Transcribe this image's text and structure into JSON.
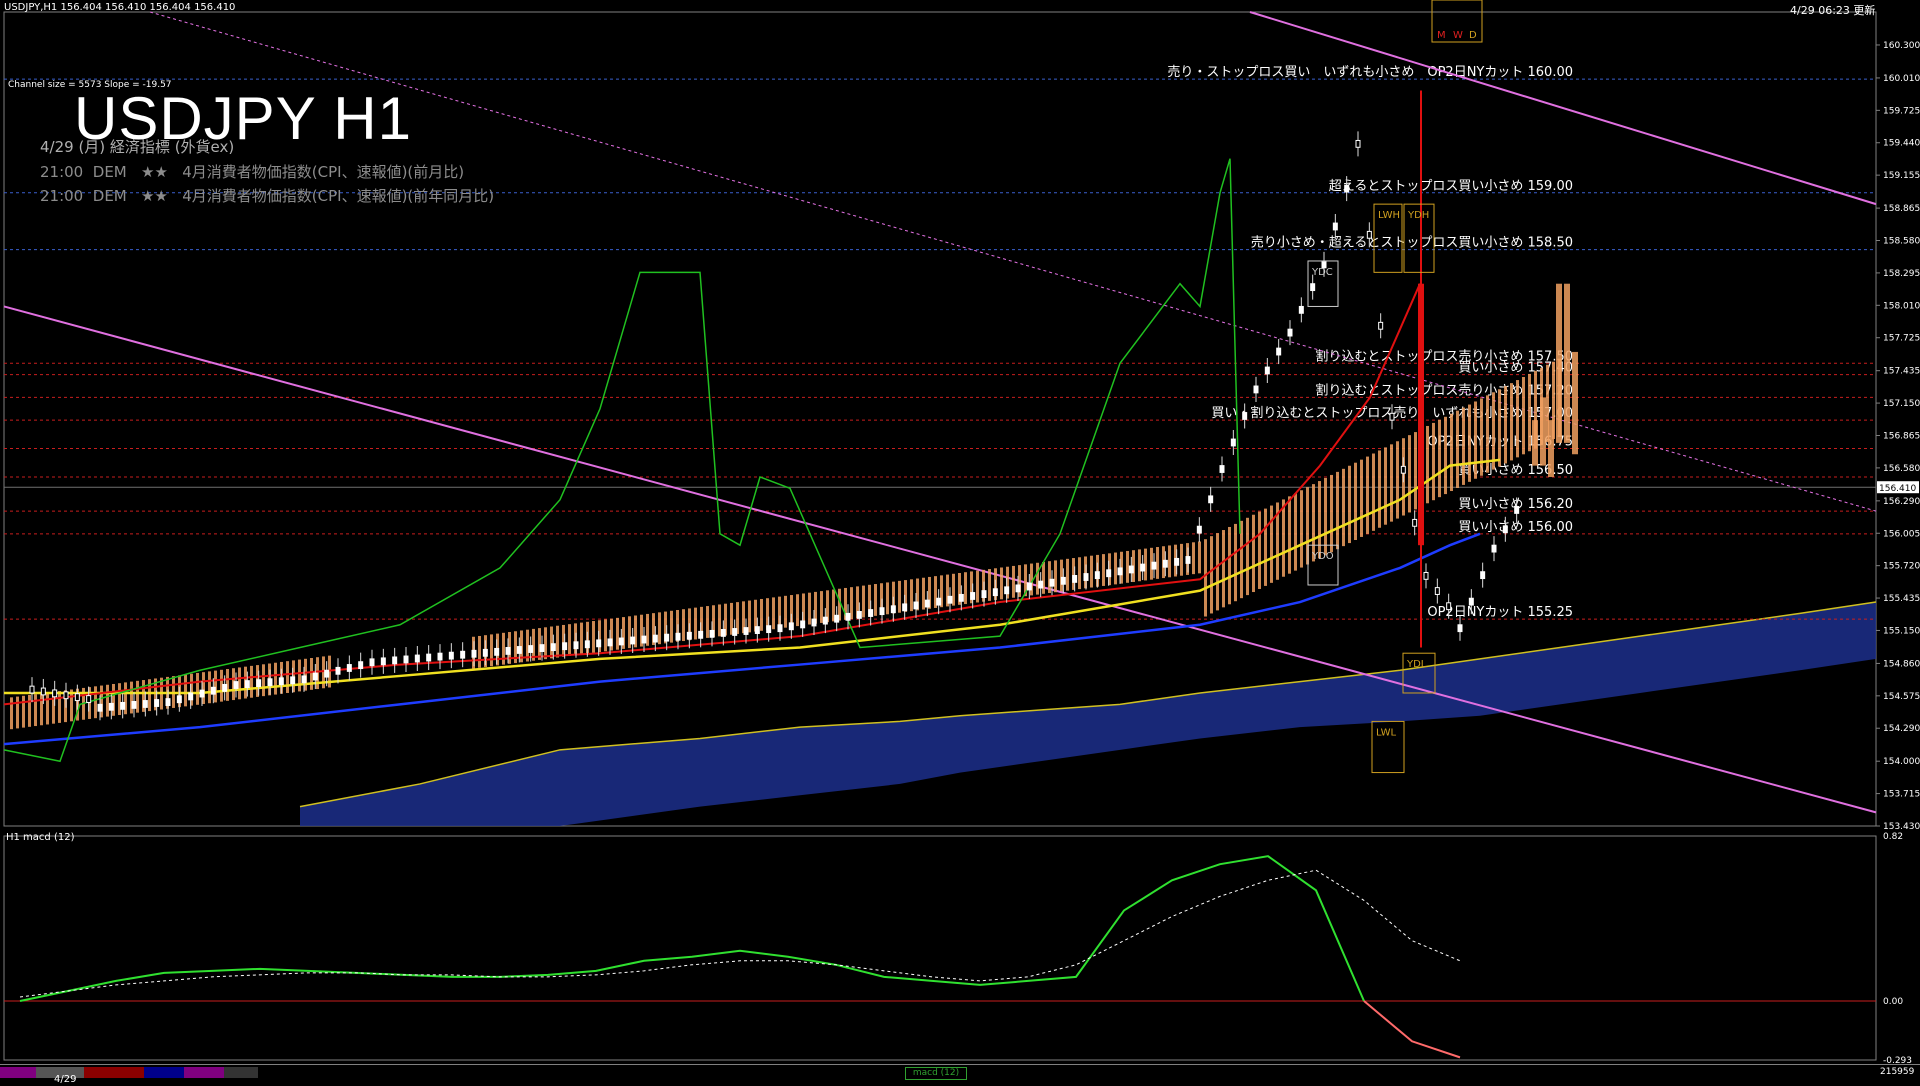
{
  "header": {
    "symbol_info": "USDJPY,H1  156.404 156.410 156.404 156.410",
    "updated": "4/29 06:23 更新"
  },
  "title": "USDJPY H1",
  "channel_info": "Channel size = 5573 Slope = -19.57",
  "events": {
    "heading": "4/29 (月) 経済指標 (外貨ex)",
    "rows": [
      "21:00  DEM   ★★   4月消費者物価指数(CPI、速報値)(前月比)",
      "21:00  DEM   ★★   4月消費者物価指数(CPI、速報値)(前年同月比)"
    ]
  },
  "mwd": [
    "M",
    "W",
    "D"
  ],
  "box_labels": {
    "ydc_top": "YDC",
    "lwh": "LWH",
    "ydh": "YDH",
    "ydo": "YDO",
    "ydl": "YDL",
    "lwl": "LWL"
  },
  "subwindow_label": "H1  macd (12)",
  "bottom_tab_date": "4/29",
  "bottom_right_number": "215959",
  "bottom_mid_label": "macd (12)",
  "colors": {
    "background": "#000000",
    "level_blue": "#3a5fcd",
    "level_red": "#c81e1e",
    "channel": "#e070e0",
    "kumo": "#1c2f8c",
    "ma_yellow": "#f0e020",
    "ma_blue": "#1e3cff",
    "ma_red": "#e01010",
    "chikou_green": "#20c020",
    "macd_green": "#30e030",
    "macd_signal": "#ffffff",
    "macd_neg": "#ff6a6a",
    "bar_orange": "#f0a060"
  },
  "chart_data": {
    "type": "line",
    "title": "USDJPY H1",
    "ylabel": "",
    "ylim": [
      153.43,
      160.59
    ],
    "y_ticks": [
      "160.300",
      "160.010",
      "159.725",
      "159.440",
      "159.155",
      "158.865",
      "158.580",
      "158.295",
      "158.010",
      "157.725",
      "157.435",
      "157.150",
      "156.865",
      "156.580",
      "156.290",
      "156.005",
      "155.720",
      "155.435",
      "155.150",
      "154.860",
      "154.575",
      "154.290",
      "154.000",
      "153.715",
      "153.430"
    ],
    "current_price": "156.410",
    "levels": [
      {
        "price": 160.0,
        "label": "売り・ストップロス買い　いずれも小さめ　OP2日NYカット 160.00",
        "color": "blue"
      },
      {
        "price": 159.0,
        "label": "超えるとストップロス買い小さめ 159.00",
        "color": "blue"
      },
      {
        "price": 158.5,
        "label": "売り小さめ・超えるとストップロス買い小さめ 158.50",
        "color": "blue"
      },
      {
        "price": 157.5,
        "label": "割り込むとストップロス売り小さめ 157.50",
        "color": "red"
      },
      {
        "price": 157.4,
        "label": "買い小さめ 157.40",
        "color": "red"
      },
      {
        "price": 157.2,
        "label": "割り込むとストップロス売り小さめ 157.20",
        "color": "red"
      },
      {
        "price": 157.0,
        "label": "買い・割り込むとストップロス売り　いずれも小さめ 157.00",
        "color": "red"
      },
      {
        "price": 156.75,
        "label": "OP2日NYカット 156.75",
        "color": "red"
      },
      {
        "price": 156.5,
        "label": "買い小さめ 156.50",
        "color": "red"
      },
      {
        "price": 156.2,
        "label": "買い小さめ 156.20",
        "color": "red"
      },
      {
        "price": 156.0,
        "label": "買い小さめ 156.00",
        "color": "red"
      },
      {
        "price": 155.25,
        "label": "OP2日NYカット 155.25",
        "color": "red"
      }
    ],
    "series": [
      {
        "name": "close",
        "x": [
          0,
          10,
          20,
          30,
          40,
          50,
          60,
          70,
          80,
          90,
          100,
          110,
          120,
          130,
          140,
          150,
          160,
          170,
          175,
          180,
          185,
          190,
          195,
          200,
          205,
          210,
          215,
          220
        ],
        "values": [
          154.6,
          154.5,
          154.55,
          154.7,
          154.75,
          154.9,
          154.95,
          155.0,
          155.05,
          155.1,
          155.15,
          155.2,
          155.3,
          155.4,
          155.5,
          155.6,
          155.7,
          155.8,
          156.6,
          157.3,
          157.8,
          158.4,
          159.4,
          157.0,
          155.6,
          155.2,
          155.9,
          156.41
        ]
      }
    ],
    "macd": {
      "ylim": [
        -0.293,
        0.82
      ],
      "y_ticks": [
        "0.82",
        "0.00",
        "-0.293"
      ],
      "main": [
        0.0,
        0.05,
        0.1,
        0.14,
        0.15,
        0.16,
        0.15,
        0.14,
        0.13,
        0.12,
        0.12,
        0.13,
        0.15,
        0.2,
        0.22,
        0.25,
        0.22,
        0.18,
        0.12,
        0.1,
        0.08,
        0.1,
        0.12,
        0.45,
        0.6,
        0.68,
        0.72,
        0.55,
        0.0,
        -0.2,
        -0.28
      ],
      "signal": [
        0.02,
        0.05,
        0.08,
        0.1,
        0.12,
        0.13,
        0.14,
        0.14,
        0.13,
        0.13,
        0.12,
        0.12,
        0.13,
        0.15,
        0.18,
        0.2,
        0.2,
        0.18,
        0.15,
        0.12,
        0.1,
        0.12,
        0.18,
        0.3,
        0.42,
        0.52,
        0.6,
        0.65,
        0.5,
        0.3,
        0.2
      ]
    }
  }
}
